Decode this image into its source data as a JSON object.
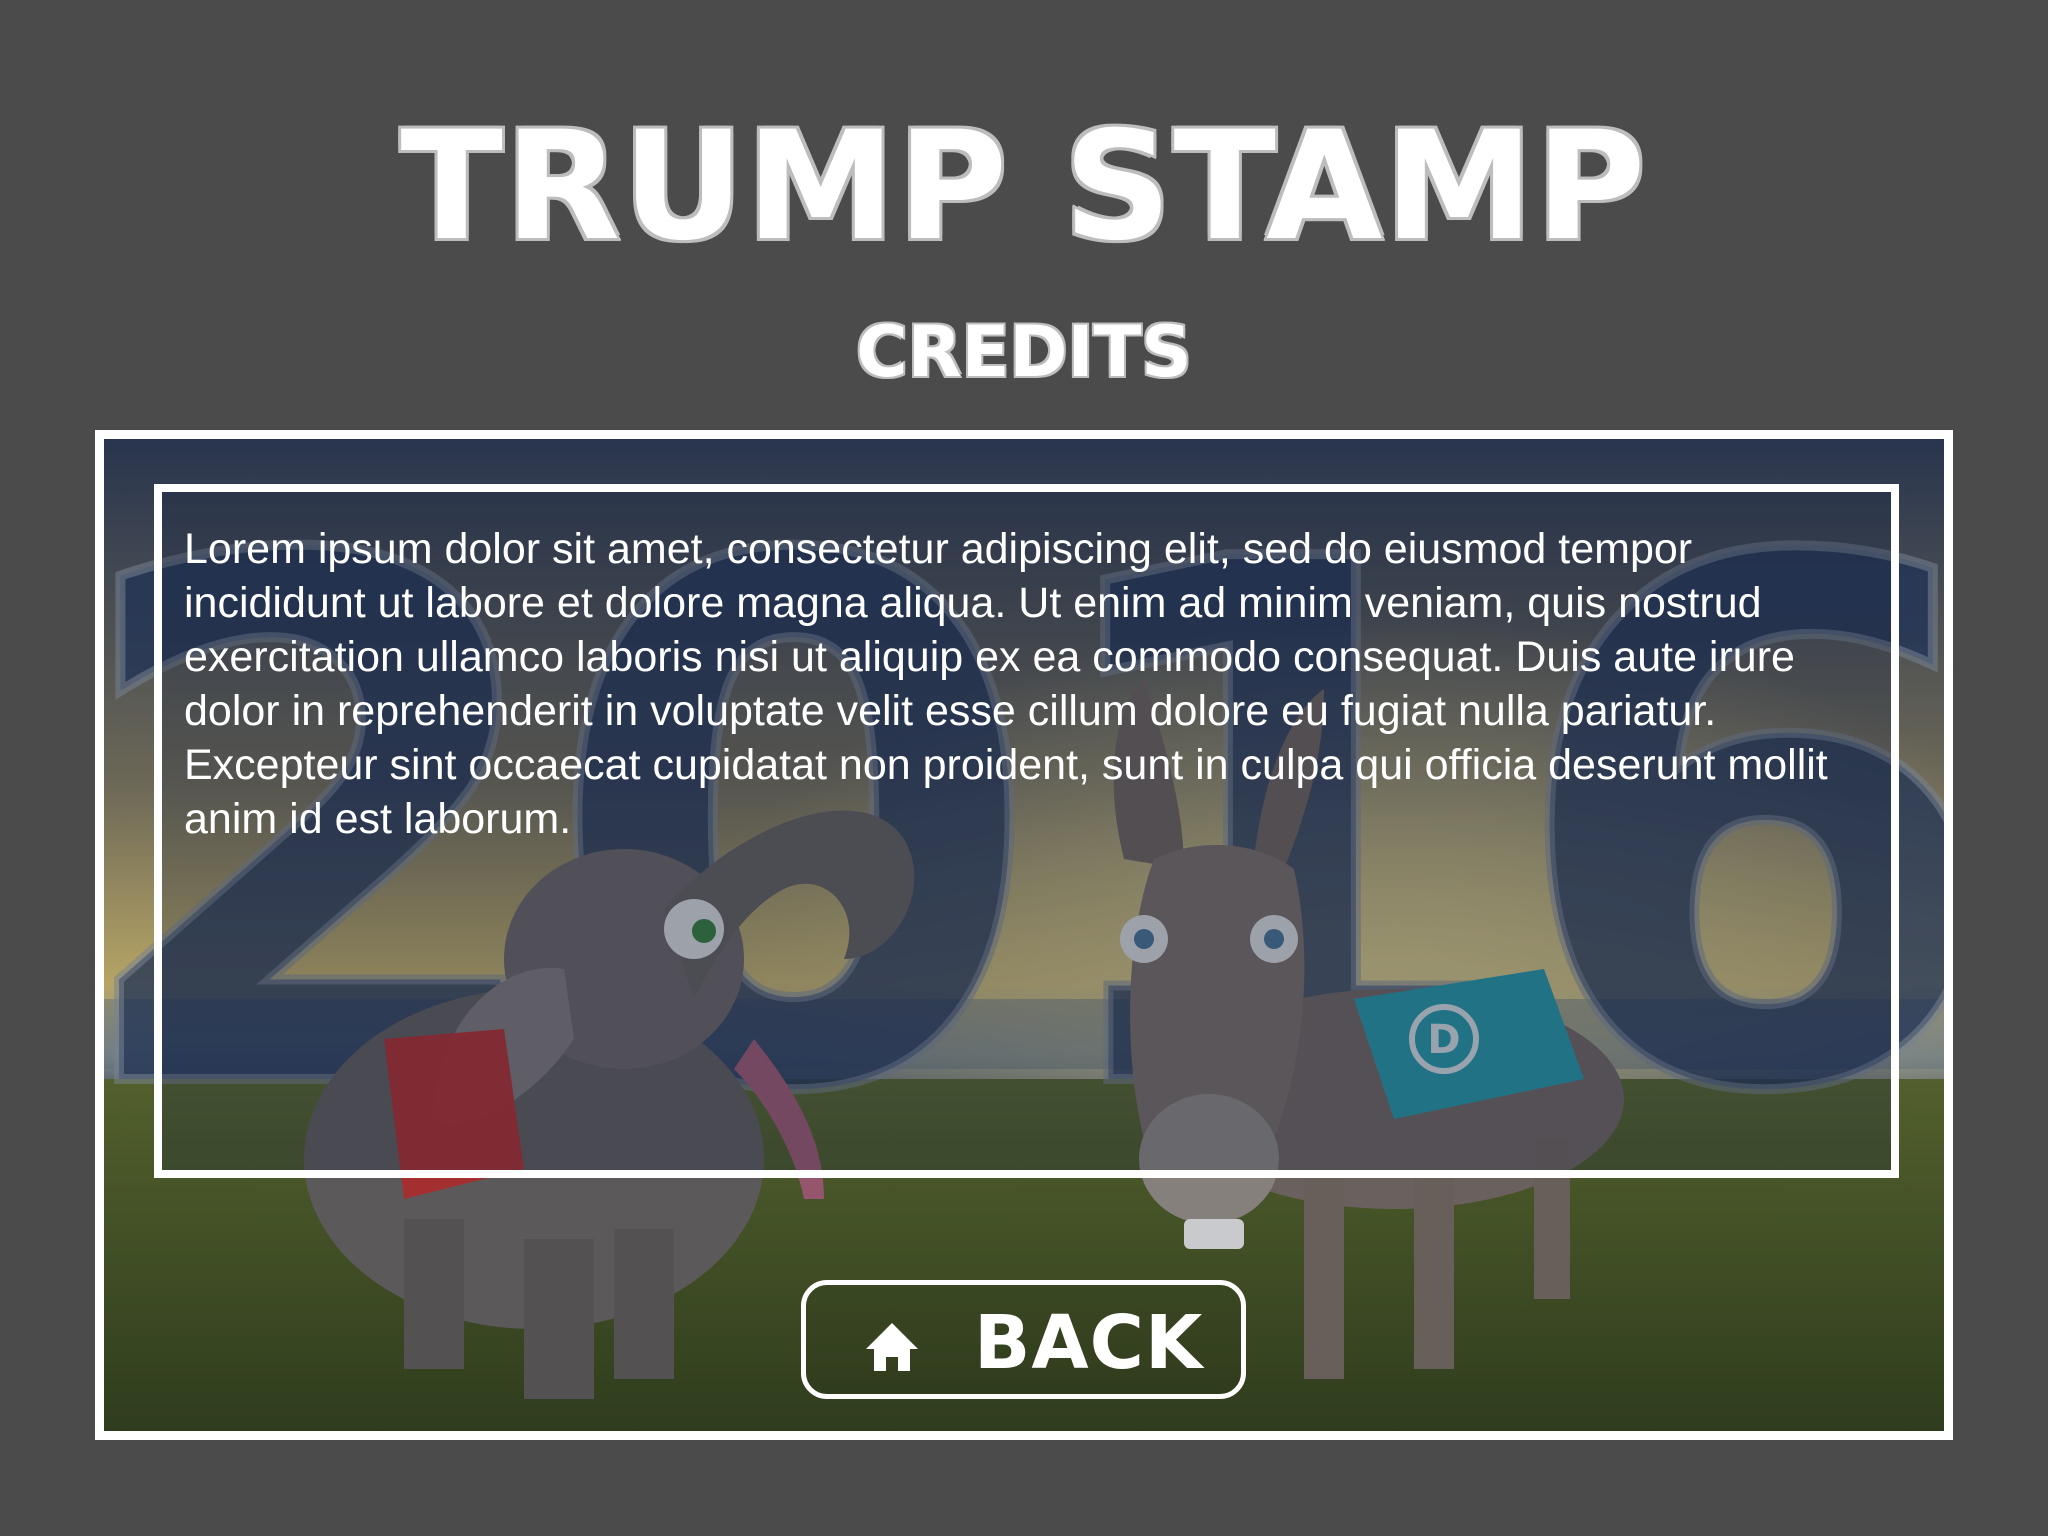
{
  "header": {
    "game_title": "TRUMP STAMP",
    "screen_title": "CREDITS"
  },
  "background": {
    "watermark_year": "2016",
    "elephant_blanket_color": "#c8302e",
    "donkey_blanket_color": "#2aa7b8",
    "donkey_blanket_letter": "D"
  },
  "credits": {
    "body": "Lorem ipsum dolor sit amet, consectetur adipiscing elit, sed do eiusmod tempor incididunt ut labore et dolore magna aliqua. Ut enim ad minim veniam, quis nostrud exercitation ullamco laboris nisi ut aliquip ex ea commodo consequat. Duis aute irure dolor in reprehenderit in voluptate velit esse cillum dolore eu fugiat nulla pariatur. Excepteur sint occaecat cupidatat non proident, sunt in culpa qui officia deserunt mollit anim id est laborum."
  },
  "back_button": {
    "icon": "home-icon",
    "label": "BACK"
  },
  "colors": {
    "page_background": "#4b4b4b",
    "frame": "#ffffff",
    "text": "#ffffff"
  }
}
